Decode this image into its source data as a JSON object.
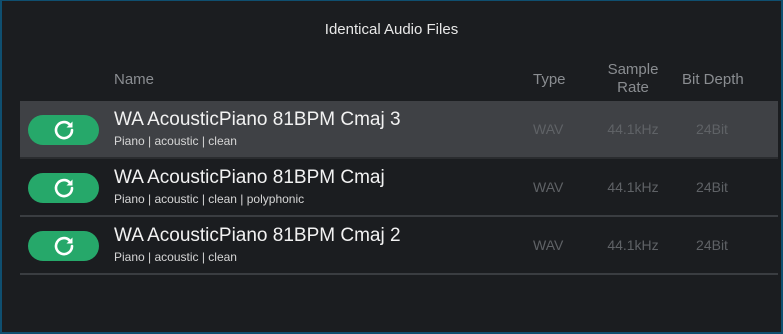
{
  "dialog": {
    "title": "Identical Audio Files"
  },
  "columns": {
    "name": "Name",
    "type": "Type",
    "sample_rate": "Sample Rate",
    "bit_depth": "Bit Depth"
  },
  "rows": [
    {
      "name": "WA AcousticPiano 81BPM Cmaj 3",
      "tags": "Piano | acoustic | clean",
      "type": "WAV",
      "sample_rate": "44.1kHz",
      "bit_depth": "24Bit",
      "selected": true
    },
    {
      "name": "WA AcousticPiano 81BPM Cmaj",
      "tags": "Piano | acoustic | clean | polyphonic",
      "type": "WAV",
      "sample_rate": "44.1kHz",
      "bit_depth": "24Bit",
      "selected": false
    },
    {
      "name": "WA AcousticPiano 81BPM Cmaj 2",
      "tags": "Piano | acoustic | clean",
      "type": "WAV",
      "sample_rate": "44.1kHz",
      "bit_depth": "24Bit",
      "selected": false
    }
  ],
  "colors": {
    "accent": "#26a86a",
    "border": "#0f4f70",
    "selected_row": "#3f4145"
  },
  "icons": {
    "row_action": "reload-icon"
  }
}
